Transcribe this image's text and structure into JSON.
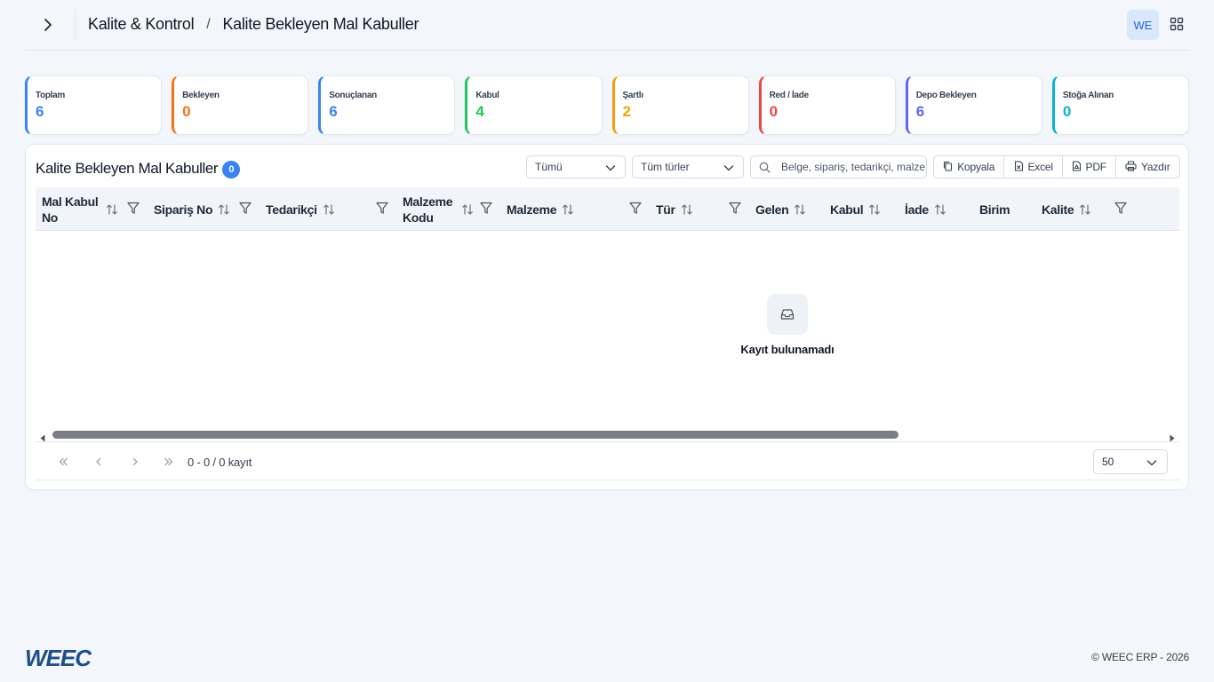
{
  "header": {
    "breadcrumb_parent": "Kalite & Kontrol",
    "breadcrumb_separator": "/",
    "breadcrumb_current": "Kalite Bekleyen Mal Kabuller",
    "avatar_initials": "WE"
  },
  "stats": [
    {
      "label": "Toplam",
      "value": "6",
      "color": "#3b82f6"
    },
    {
      "label": "Bekleyen",
      "value": "0",
      "color": "#f97316"
    },
    {
      "label": "Sonuçlanan",
      "value": "6",
      "color": "#3b82f6"
    },
    {
      "label": "Kabul",
      "value": "4",
      "color": "#22c55e"
    },
    {
      "label": "Şartlı",
      "value": "2",
      "color": "#f59e0b"
    },
    {
      "label": "Red / İade",
      "value": "0",
      "color": "#ef4444"
    },
    {
      "label": "Depo Bekleyen",
      "value": "6",
      "color": "#6366f1"
    },
    {
      "label": "Stoğa Alınan",
      "value": "0",
      "color": "#06b6d4"
    }
  ],
  "panel": {
    "title": "Kalite Bekleyen Mal Kabuller",
    "count": "0",
    "status_filter": "Tümü",
    "type_filter": "Tüm türler",
    "search_placeholder": "Belge, sipariş, tedarikçi, malzeme",
    "export": {
      "copy": "Kopyala",
      "excel": "Excel",
      "pdf": "PDF",
      "print": "Yazdır"
    }
  },
  "table": {
    "columns": [
      {
        "label": "Mal Kabul No",
        "sortable": true,
        "filterable": true
      },
      {
        "label": "Sipariş No",
        "sortable": true,
        "filterable": true
      },
      {
        "label": "Tedarikçi",
        "sortable": true,
        "filterable": true
      },
      {
        "label": "Malzeme Kodu",
        "sortable": true,
        "filterable": true
      },
      {
        "label": "Malzeme",
        "sortable": true,
        "filterable": true
      },
      {
        "label": "Tür",
        "sortable": true,
        "filterable": true
      },
      {
        "label": "Gelen",
        "sortable": true,
        "filterable": false
      },
      {
        "label": "Kabul",
        "sortable": true,
        "filterable": false
      },
      {
        "label": "İade",
        "sortable": true,
        "filterable": false
      },
      {
        "label": "Birim",
        "sortable": false,
        "filterable": false
      },
      {
        "label": "Kalite",
        "sortable": true,
        "filterable": true
      }
    ],
    "rows": [],
    "empty_message": "Kayıt bulunamadı"
  },
  "pagination": {
    "info": "0 - 0 / 0 kayıt",
    "rows_per_page": "50"
  },
  "footer": {
    "logo_text": "WEEC",
    "copyright": "© WEEC ERP - 2026"
  }
}
